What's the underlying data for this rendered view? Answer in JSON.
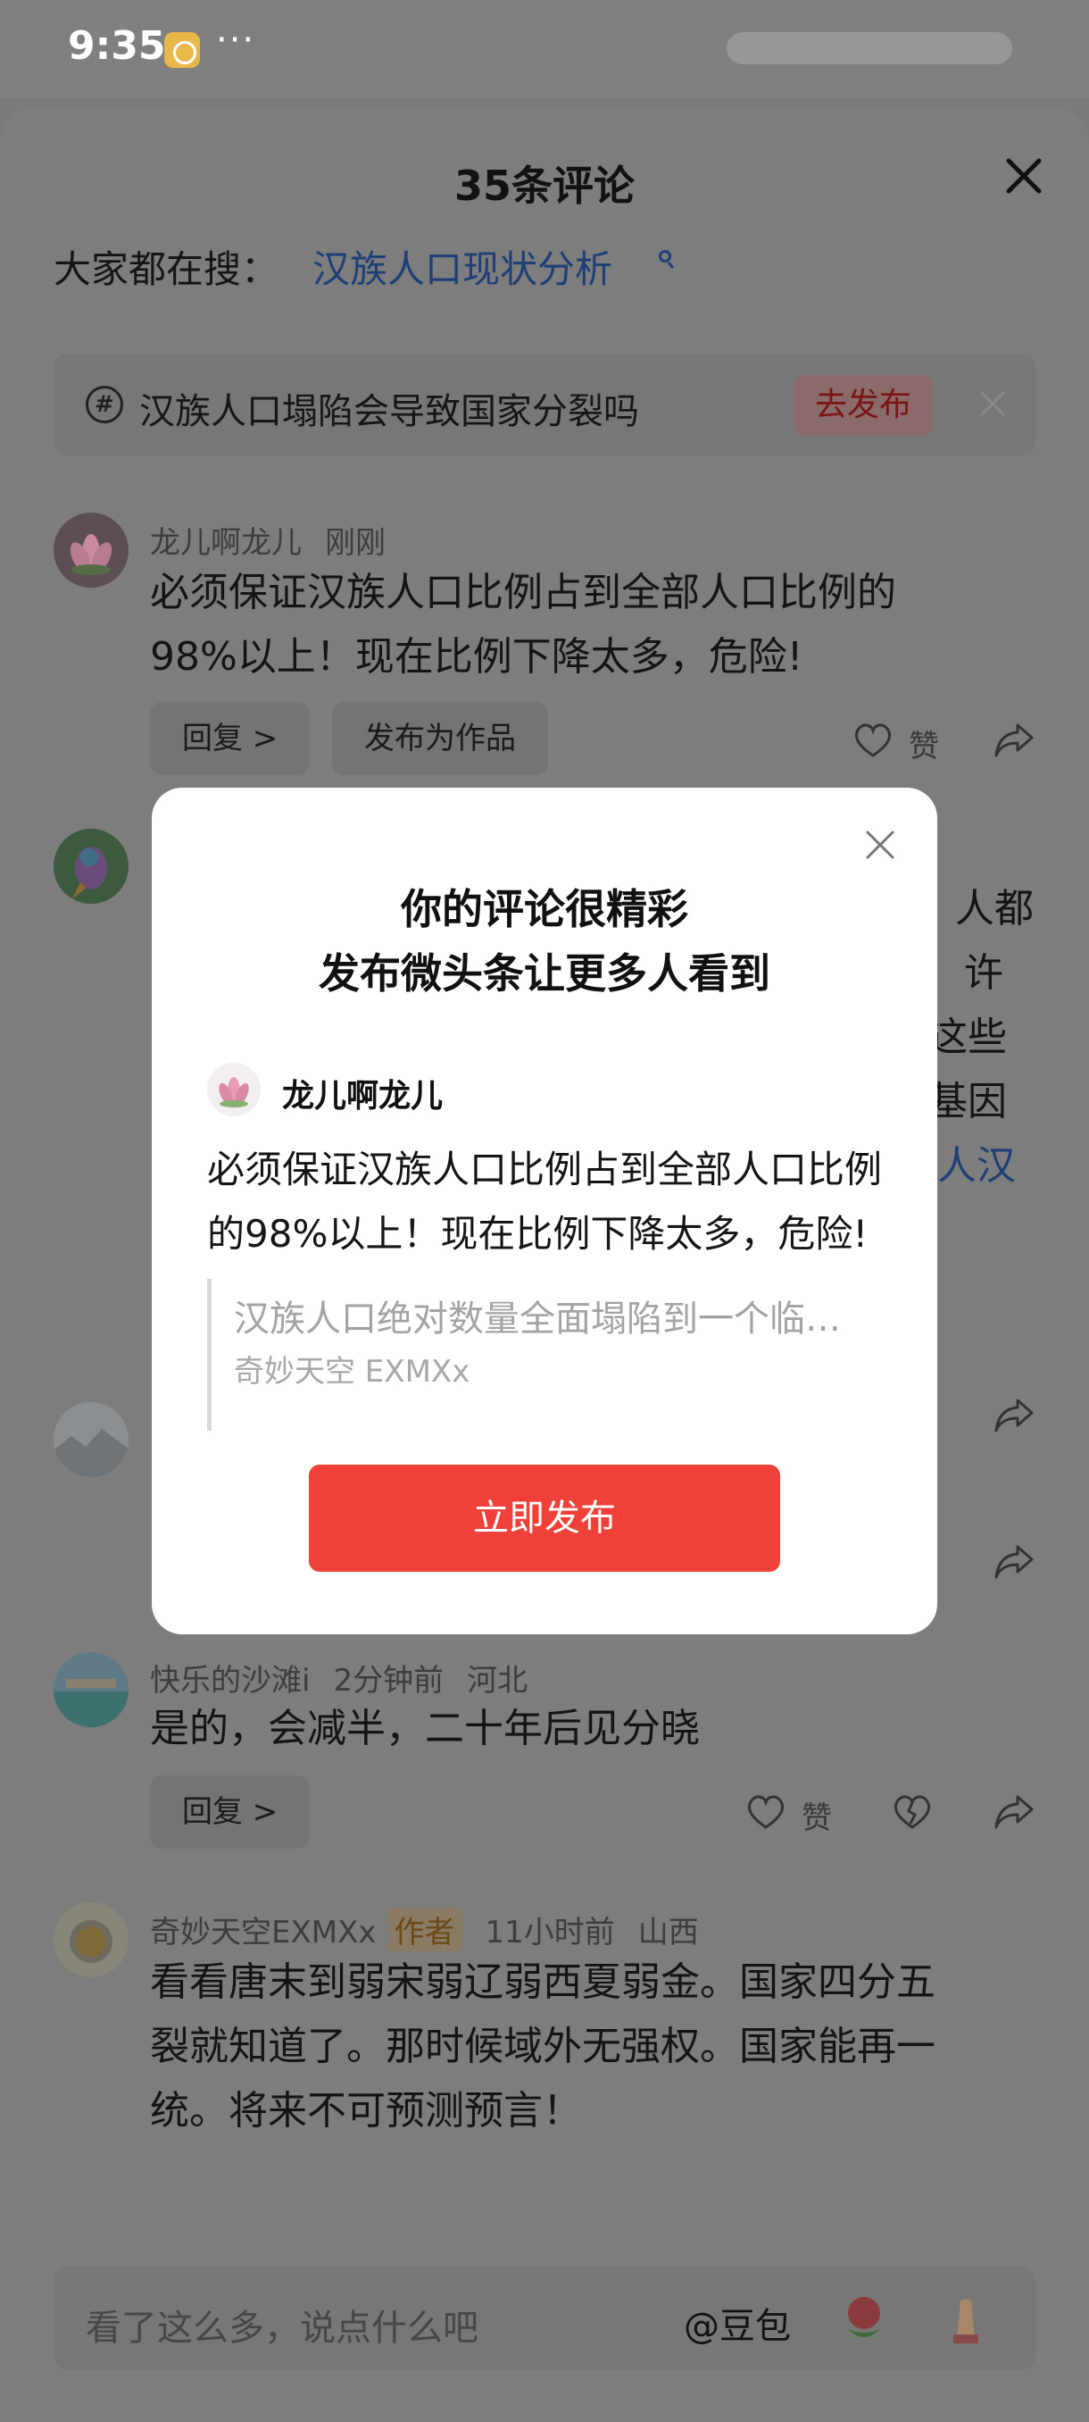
{
  "status_bar": {
    "time": "9:35",
    "more": "···"
  },
  "sheet": {
    "title": "35条评论",
    "search_prompt": "大家都在搜：",
    "search_link": "汉族人口现状分析",
    "topic": {
      "text": "汉族人口塌陷会导致国家分裂吗",
      "publish_label": "去发布"
    }
  },
  "comments": [
    {
      "user": "龙儿啊龙儿",
      "time": "刚刚",
      "text_line1": "必须保证汉族人口比例占到全部人口比例的",
      "text_line2": "98%以上！现在比例下降太多，危险!",
      "reply_label": "回复 >",
      "publish_as_work": "发布为作品",
      "like_label": "赞"
    },
    {
      "user": "快乐的沙滩i",
      "time": "2分钟前",
      "location": "河北",
      "text": "是的，会减半，二十年后见分晓",
      "reply_label": "回复 >",
      "like_label": "赞"
    },
    {
      "user": "奇妙天空EXMXx",
      "tag": "作者",
      "time": "11小时前",
      "location": "山西",
      "text_line1": "看看唐末到弱宋弱辽弱西夏弱金。国家四分五",
      "text_line2": "裂就知道了。那时候域外无强权。国家能再一",
      "text_line3": "统。将来不可预测预言！"
    }
  ],
  "peek_fragments": [
    "人都",
    "许",
    "这些",
    "基因",
    "人汉"
  ],
  "input_bar": {
    "placeholder": "看了这么多，说点什么吧",
    "mention": "@豆包"
  },
  "modal": {
    "title_line1": "你的评论很精彩",
    "title_line2": "发布微头条让更多人看到",
    "user": "龙儿啊龙儿",
    "comment_line1": "必须保证汉族人口比例占到全部人口比例",
    "comment_line2": "的98%以上！现在比例下降太多，危险!",
    "quote_text": "汉族人口绝对数量全面塌陷到一个临…",
    "quote_author": "奇妙天空 EXMXx",
    "button_label": "立即发布"
  },
  "colors": {
    "accent_red": "#f04138",
    "link_blue": "#1f3f77",
    "overlay": "#7d7d7d"
  }
}
